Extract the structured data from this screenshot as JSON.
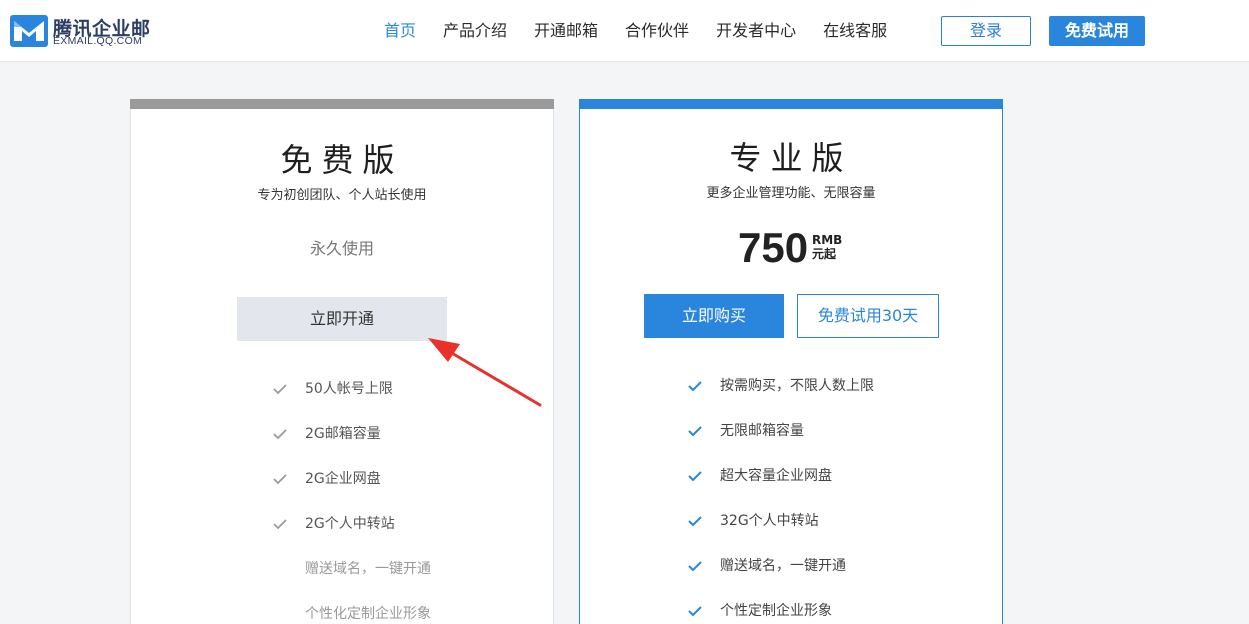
{
  "header": {
    "logo": {
      "name": "腾讯企业邮",
      "domain": "EXMAIL.QQ.COM"
    },
    "nav": [
      {
        "label": "首页",
        "active": true
      },
      {
        "label": "产品介绍",
        "active": false
      },
      {
        "label": "开通邮箱",
        "active": false
      },
      {
        "label": "合作伙伴",
        "active": false
      },
      {
        "label": "开发者中心",
        "active": false
      },
      {
        "label": "在线客服",
        "active": false
      }
    ],
    "login_label": "登录",
    "trial_label": "免费试用"
  },
  "plans": {
    "free": {
      "title": "免费版",
      "subtitle": "专为初创团队、个人站长使用",
      "duration": "永久使用",
      "button": "立即开通",
      "features": [
        {
          "text": "50人帐号上限",
          "checked": true
        },
        {
          "text": "2G邮箱容量",
          "checked": true
        },
        {
          "text": "2G企业网盘",
          "checked": true
        },
        {
          "text": "2G个人中转站",
          "checked": true
        },
        {
          "text": "赠送域名，一键开通",
          "checked": false
        },
        {
          "text": "个性化定制企业形象",
          "checked": false
        }
      ]
    },
    "pro": {
      "title": "专业版",
      "subtitle": "更多企业管理功能、无限容量",
      "price": "750",
      "price_currency": "RMB",
      "price_suffix": "元起",
      "buy_button": "立即购买",
      "trial_button": "免费试用30天",
      "features": [
        {
          "text": "按需购买，不限人数上限",
          "checked": true
        },
        {
          "text": "无限邮箱容量",
          "checked": true
        },
        {
          "text": "超大容量企业网盘",
          "checked": true
        },
        {
          "text": "32G个人中转站",
          "checked": true
        },
        {
          "text": "赠送域名，一键开通",
          "checked": true
        },
        {
          "text": "个性定制企业形象",
          "checked": true
        }
      ]
    }
  },
  "colors": {
    "accent": "#2a86dd",
    "free_bar": "#9b9b9b",
    "annotation_arrow": "#e8312a"
  },
  "icons": [
    "logo-mark-icon",
    "check-icon",
    "annotation-arrow-icon"
  ]
}
